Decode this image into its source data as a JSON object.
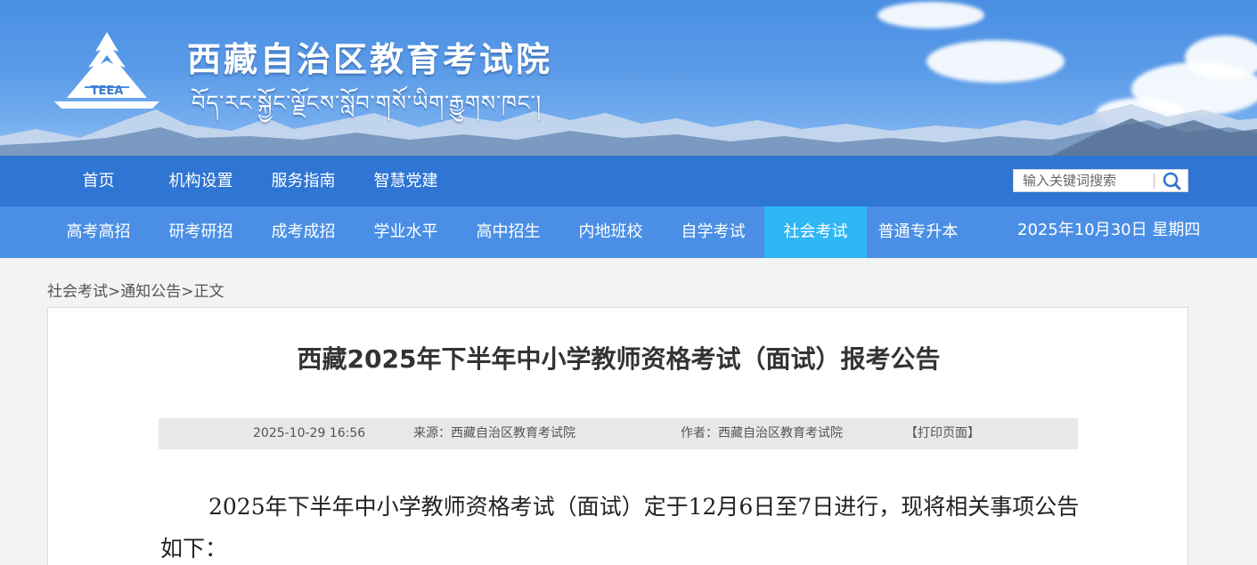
{
  "header": {
    "logo_text": "TEEA",
    "title": "西藏自治区教育考试院",
    "subtitle_tibetan": "བོད་རང་སྐྱོང་ལྗོངས་སློབ་གསོ་ཡིག་རྒྱུགས་ཁང་།"
  },
  "nav_primary": {
    "items": [
      "首页",
      "机构设置",
      "服务指南",
      "智慧党建"
    ]
  },
  "search": {
    "placeholder": "输入关键词搜索",
    "icon": "search-icon"
  },
  "nav_secondary": {
    "items": [
      "高考高招",
      "研考研招",
      "成考成招",
      "学业水平",
      "高中招生",
      "内地班校",
      "自学考试",
      "社会考试",
      "普通专升本"
    ],
    "active": "社会考试",
    "date": "2025年10月30日 星期四"
  },
  "breadcrumb": {
    "items": [
      "社会考试",
      "通知公告",
      "正文"
    ],
    "separator": ">"
  },
  "article": {
    "title": "西藏2025年下半年中小学教师资格考试（面试）报考公告",
    "datetime": "2025-10-29 16:56",
    "source": "来源：西藏自治区教育考试院",
    "author": "作者：西藏自治区教育考试院",
    "print": "【打印页面】",
    "body": "2025年下半年中小学教师资格考试（面试）定于12月6日至7日进行，现将相关事项公告如下："
  },
  "colors": {
    "nav_primary_bg": "#2f75d3",
    "nav_secondary_bg": "#4a8fe5",
    "nav_active_bg": "#2fb6f4",
    "page_bg": "#f3f3f3"
  }
}
